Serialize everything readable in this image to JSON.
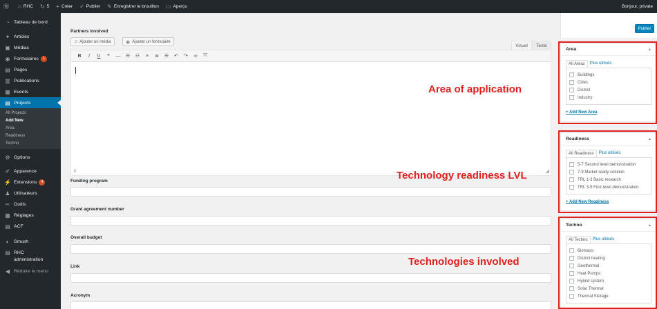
{
  "adminbar": {
    "site_name": "RHC",
    "updates": "5",
    "new_label": "Créer",
    "publish_label": "Publier",
    "save_draft_label": "Enregistrer le brouillon",
    "preview_label": "Aperçu",
    "greeting": "Bonjour, private"
  },
  "sidebar": {
    "dashboard": "Tableau de bord",
    "articles": "Articles",
    "medias": "Médias",
    "formulaires": "Formulaires",
    "formulaires_badge": "1",
    "pages": "Pages",
    "publications": "Publications",
    "events": "Events",
    "projects": "Projects",
    "submenu": [
      "All Projects",
      "Add New",
      "Area",
      "Readiness",
      "Techno"
    ],
    "options": "Options",
    "apparence": "Apparence",
    "extensions": "Extensions",
    "extensions_badge": "4",
    "utilisateurs": "Utilisateurs",
    "outils": "Outils",
    "reglages": "Réglages",
    "acf": "ACF",
    "smush": "Smush",
    "rhc_admin_1": "RHC",
    "rhc_admin_2": "administration",
    "collapse": "Réduire le menu"
  },
  "main": {
    "partners_label": "Partners involved",
    "add_media": "Ajouter un média",
    "add_form": "Ajouter un formulaire",
    "tab_visual": "Visuel",
    "tab_text": "Texte",
    "path": "p",
    "funding_label": "Funding program",
    "grant_label": "Grant agreement number",
    "budget_label": "Overall budget",
    "link_label": "Link",
    "acronym_label": "Acronym"
  },
  "publish": {
    "button": "Publier"
  },
  "area": {
    "title": "Area",
    "tab_all": "All Areas",
    "tab_popular": "Plus utilisés",
    "terms": [
      "Buildings",
      "Cities",
      "District",
      "Industry"
    ],
    "add_new": "+ Add New Area"
  },
  "readiness": {
    "title": "Readiness",
    "tab_all": "All Readiness",
    "tab_popular": "Plus utilisés",
    "terms": [
      "5-7 Second level demonstration",
      "7-9 Market ready solution",
      "TRL 1-3 Basic research",
      "TRL 3-5 First level demonstration"
    ],
    "add_new": "+ Add New Readiness"
  },
  "techno": {
    "title": "Techno",
    "tab_all": "All Techno",
    "tab_popular": "Plus utilisés",
    "terms": [
      "Biomass",
      "District heating",
      "Geothermal",
      "Heat Pumps",
      "Hybrid system",
      "Solar Thermal",
      "Thermal Storage"
    ]
  },
  "annotations": {
    "area": "Area of application",
    "readiness": "Technology readiness LVL",
    "techno": "Technologies involved"
  },
  "colors": {
    "accent": "#0073aa",
    "annotation": "#e0201e",
    "sidebar": "#23282d"
  }
}
